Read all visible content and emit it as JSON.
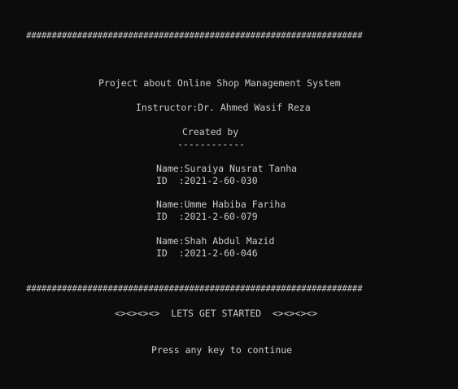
{
  "console": {
    "separator_top": "##################################################################",
    "project_title": "Project about Online Shop Management System",
    "instructor": "Instructor:Dr. Ahmed Wasif Reza",
    "created_by": "Created by",
    "underline": "------------",
    "members": [
      {
        "name": "Name:Suraiya Nusrat Tanha",
        "id": "ID  :2021-2-60-030"
      },
      {
        "name": "Name:Umme Habiba Fariha",
        "id": "ID  :2021-2-60-079"
      },
      {
        "name": "Name:Shah Abdul Mazid",
        "id": "ID  :2021-2-60-046"
      }
    ],
    "separator_bottom": "##################################################################",
    "lets_get_started": "<><><><>  LETS GET STARTED  <><><><>",
    "press_any_key": "Press any key to continue"
  }
}
